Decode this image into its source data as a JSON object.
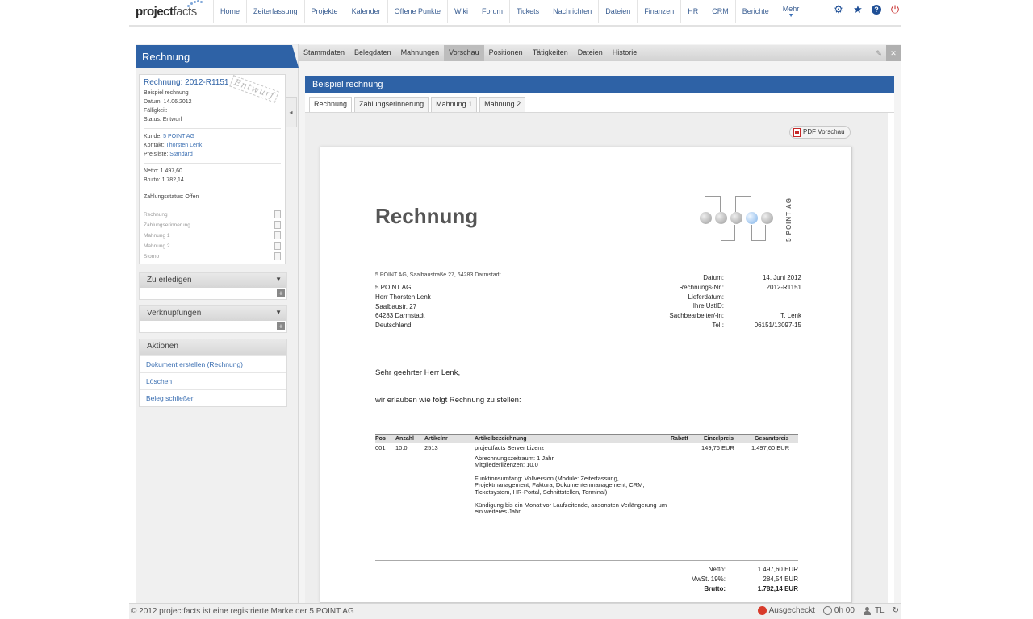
{
  "brand": {
    "name_bold": "project",
    "name_rest": "facts"
  },
  "nav": {
    "items": [
      "Home",
      "Zeiterfassung",
      "Projekte",
      "Kalender",
      "Offene Punkte",
      "Wiki",
      "Forum",
      "Tickets",
      "Nachrichten",
      "Dateien",
      "Finanzen",
      "HR",
      "CRM",
      "Berichte"
    ],
    "more_label": "Mehr",
    "icons": [
      "gear-icon",
      "star-icon",
      "help-icon",
      "power-icon"
    ]
  },
  "left": {
    "title": "Rechnung",
    "record": {
      "title": "Rechnung: 2012-R1151",
      "subtitle": "Beispiel rechnung",
      "stamp": "Entwurf",
      "datum": "Datum: 14.06.2012",
      "faelligkeit": "Fälligkeit:",
      "status": "Status: Entwurf",
      "kunde_label": "Kunde:",
      "kunde": "5 POINT AG",
      "kontakt_label": "Kontakt:",
      "kontakt": "Thorsten Lenk",
      "preisliste_label": "Preisliste:",
      "preisliste": "Standard",
      "netto": "Netto: 1.497,60",
      "brutto": "Brutto: 1.782,14",
      "zahlungsstatus": "Zahlungsstatus: Offen",
      "documents": [
        "Rechnung",
        "Zahlungserinnerung",
        "Mahnung 1",
        "Mahnung 2",
        "Storno"
      ]
    },
    "zu_erledigen": "Zu erledigen",
    "verknuepfungen": "Verknüpfungen",
    "aktionen": {
      "title": "Aktionen",
      "items": [
        "Dokument erstellen (Rechnung)",
        "Löschen",
        "Beleg schließen"
      ]
    }
  },
  "tabs": {
    "items": [
      "Stammdaten",
      "Belegdaten",
      "Mahnungen",
      "Vorschau",
      "Positionen",
      "Tätigkeiten",
      "Dateien",
      "Historie"
    ],
    "active": "Vorschau"
  },
  "panel": {
    "title": "Beispiel rechnung",
    "subtabs": [
      "Rechnung",
      "Zahlungserinnerung",
      "Mahnung 1",
      "Mahnung 2"
    ],
    "pdf_button": "PDF Vorschau"
  },
  "invoice": {
    "title": "Rechnung",
    "logo_text": "5 POINT AG",
    "sender_line": "5 POINT AG, Saalbaustraße 27, 64283 Darmstadt",
    "address": [
      "5 POINT AG",
      "Herr Thorsten Lenk",
      "Saalbaustr. 27",
      "64283 Darmstadt",
      "Deutschland"
    ],
    "meta": [
      {
        "label": "Datum:",
        "value": "14. Juni 2012"
      },
      {
        "label": "Rechnungs-Nr.:",
        "value": "2012-R1151"
      },
      {
        "label": "Lieferdatum:",
        "value": ""
      },
      {
        "label": "Ihre UstID:",
        "value": ""
      },
      {
        "label": "Sachbearbeiter/-in:",
        "value": "T. Lenk"
      },
      {
        "label": "Tel.:",
        "value": "06151/13097-15"
      }
    ],
    "salutation": "Sehr geehrter Herr Lenk,",
    "intro": "wir erlauben wie folgt Rechnung zu stellen:",
    "columns": [
      "Pos",
      "Anzahl",
      "Artikelnr",
      "Artikelbezeichnung",
      "Rabatt",
      "Einzelpreis",
      "Gesamtpreis"
    ],
    "row": {
      "pos": "001",
      "anzahl": "10.0",
      "artikelnr": "2513",
      "bezeichnung": "projectfacts Server Lizenz",
      "rabatt": "",
      "einzelpreis": "149,76 EUR",
      "gesamtpreis": "1.497,60 EUR"
    },
    "description": [
      "Abrechnungszeitraum: 1 Jahr\nMitgliederlizenzen: 10.0",
      "Funktionsumfang: Vollversion (Module: Zeiterfassung, Projektmanagement, Faktura, Dokumentenmanagement, CRM, Ticketsystem, HR-Portal, Schnittstellen, Terminal)",
      "Kündigung bis ein Monat vor Laufzeitende, ansonsten Verlängerung um ein weiteres Jahr."
    ],
    "totals": [
      {
        "label": "Netto:",
        "value": "1.497,60 EUR",
        "bold": false
      },
      {
        "label": "MwSt. 19%:",
        "value": "284,54 EUR",
        "bold": false
      },
      {
        "label": "Brutto:",
        "value": "1.782,14 EUR",
        "bold": true
      }
    ]
  },
  "status": {
    "copyright": "© 2012 projectfacts ist eine registrierte Marke der 5 POINT AG",
    "checked": "Ausgecheckt",
    "time": "0h 00",
    "user": "TL"
  },
  "colors": {
    "accent": "#2e62a6",
    "link": "#3b6fb2",
    "alert": "#d83b2b"
  }
}
